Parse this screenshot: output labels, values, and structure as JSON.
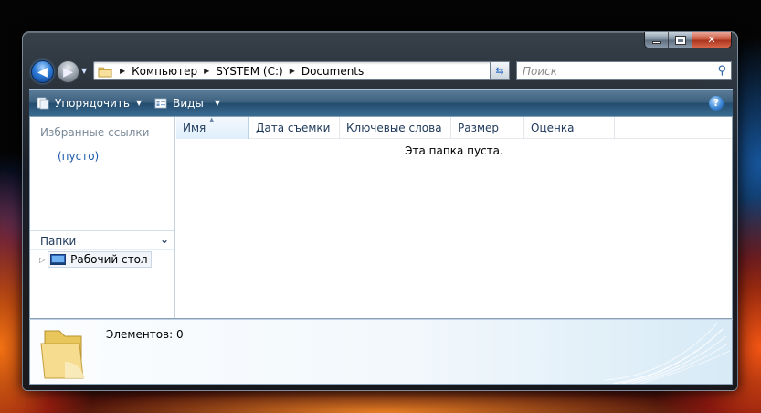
{
  "window": {
    "caption": {
      "minimize": "minimize-icon",
      "maximize": "maximize-icon",
      "close": "close-icon"
    }
  },
  "navbar": {
    "address": {
      "crumbs": [
        "Компьютер",
        "SYSTEM (C:)",
        "Documents"
      ]
    },
    "search": {
      "placeholder": "Поиск"
    }
  },
  "toolbar": {
    "organize_label": "Упорядочить",
    "views_label": "Виды",
    "help_icon": "help-icon"
  },
  "navpane": {
    "favorites_header": "Избранные ссылки",
    "favorites_empty": "(пусто)",
    "folders_header": "Папки",
    "tree": [
      {
        "label": "Рабочий стол"
      }
    ]
  },
  "filepane": {
    "columns": [
      "Имя",
      "Дата съемки",
      "Ключевые слова",
      "Размер",
      "Оценка"
    ],
    "empty_message": "Эта папка пуста."
  },
  "details": {
    "count_text": "Элементов: 0"
  },
  "colors": {
    "toolbar_top": "#5c7d98",
    "toolbar_bottom": "#234c6e",
    "link_blue": "#1e5aa8",
    "header_text": "#1e395b"
  }
}
